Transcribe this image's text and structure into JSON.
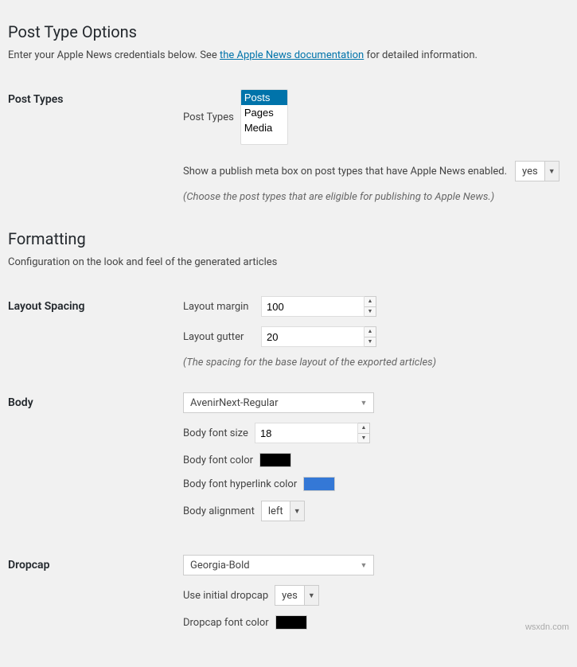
{
  "sections": {
    "postTypeOptions": {
      "heading": "Post Type Options",
      "intro_pre": "Enter your Apple News credentials below. See ",
      "intro_link": "the Apple News documentation",
      "intro_post": " for detailed information.",
      "row_label": "Post Types",
      "multiselect_label": "Post Types",
      "options": [
        "Posts",
        "Pages",
        "Media"
      ],
      "selected": "Posts",
      "metabox_label": "Show a publish meta box on post types that have Apple News enabled.",
      "metabox_value": "yes",
      "hint": "(Choose the post types that are eligible for publishing to Apple News.)"
    },
    "formatting": {
      "heading": "Formatting",
      "intro": "Configuration on the look and feel of the generated articles",
      "layout": {
        "row_label": "Layout Spacing",
        "margin_label": "Layout margin",
        "margin_value": "100",
        "gutter_label": "Layout gutter",
        "gutter_value": "20",
        "hint": "(The spacing for the base layout of the exported articles)"
      },
      "body": {
        "row_label": "Body",
        "font_value": "AvenirNext-Regular",
        "fontsize_label": "Body font size",
        "fontsize_value": "18",
        "fontcolor_label": "Body font color",
        "fontcolor_value": "#000000",
        "linkcolor_label": "Body font hyperlink color",
        "linkcolor_value": "#3478d6",
        "align_label": "Body alignment",
        "align_value": "left"
      },
      "dropcap": {
        "row_label": "Dropcap",
        "font_value": "Georgia-Bold",
        "use_label": "Use initial dropcap",
        "use_value": "yes",
        "color_label": "Dropcap font color",
        "color_value": "#000000"
      }
    }
  },
  "watermark": "wsxdn.com"
}
